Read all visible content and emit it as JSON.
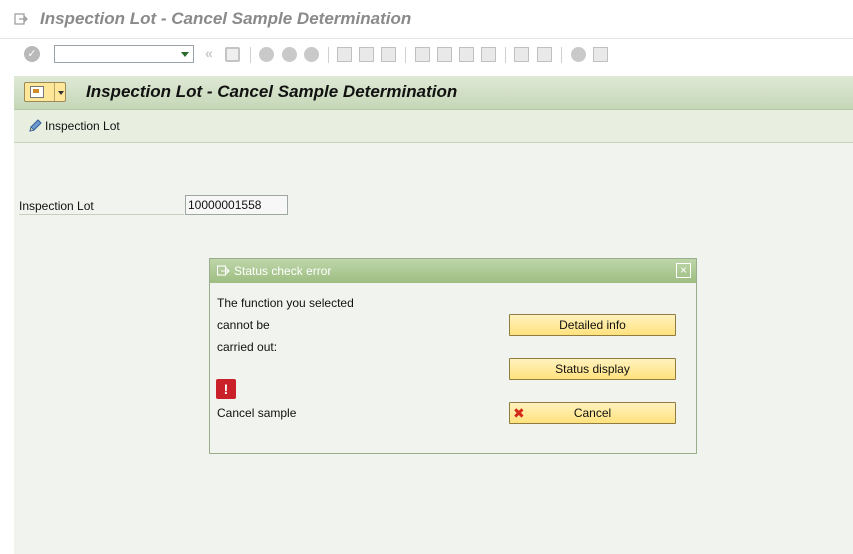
{
  "window": {
    "title": "Inspection Lot - Cancel Sample Determination"
  },
  "toolbar": {
    "command_field_value": "",
    "icons": [
      "enter-icon",
      "save-icon",
      "back-icon",
      "exit-icon",
      "cancel-icon",
      "print-icon",
      "find-icon",
      "find-next-icon",
      "first-page-icon",
      "previous-page-icon",
      "next-page-icon",
      "last-page-icon",
      "create-session-icon",
      "shortcut-icon",
      "help-icon",
      "customize-layout-icon"
    ]
  },
  "app": {
    "title": "Inspection Lot - Cancel Sample Determination",
    "toolbar_label": "Inspection Lot",
    "field_label": "Inspection Lot",
    "field_value": "10000001558"
  },
  "dialog": {
    "title": "Status check error",
    "message_lines": [
      "The function you selected",
      "cannot be",
      "carried out:"
    ],
    "action_text": "Cancel sample",
    "buttons": {
      "detailed_info": "Detailed info",
      "status_display": "Status display",
      "cancel": "Cancel"
    },
    "close_glyph": "×",
    "error_glyph": "!"
  },
  "colors": {
    "header_green": "#c5d7b7",
    "dialog_title_green": "#9dbe82",
    "button_yellow": "#ffe27e",
    "error_red": "#c9202a"
  }
}
